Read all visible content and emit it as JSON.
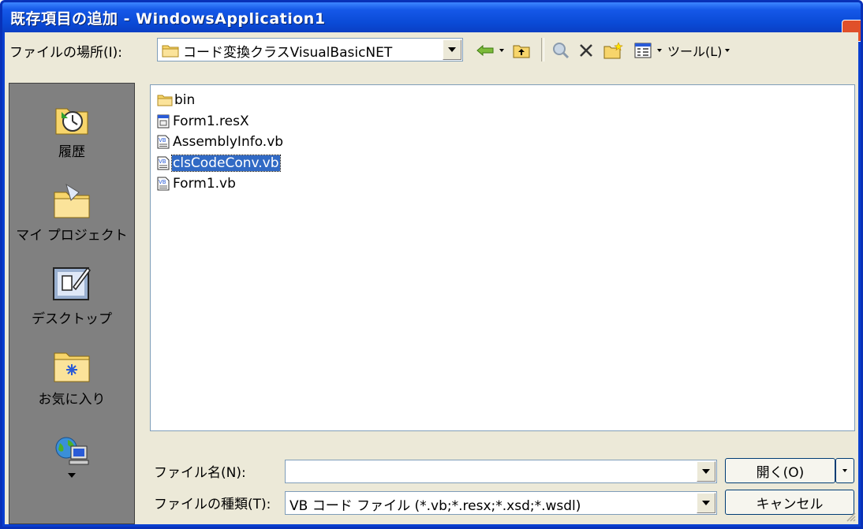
{
  "window": {
    "title": "既存項目の追加 - WindowsApplication1"
  },
  "toolbar": {
    "location_label": "ファイルの場所(I):",
    "location_value": "コード変換クラスVisualBasicNET",
    "tools_label": "ツール(L)"
  },
  "places": [
    {
      "label": "履歴",
      "icon": "history-icon"
    },
    {
      "label": "マイ プロジェクト",
      "icon": "my-projects-folder-icon"
    },
    {
      "label": "デスクトップ",
      "icon": "desktop-icon"
    },
    {
      "label": "お気に入り",
      "icon": "favorites-folder-icon"
    },
    {
      "label": "",
      "icon": "network-computer-icon"
    }
  ],
  "files": [
    {
      "name": "bin",
      "icon": "folder-icon",
      "selected": false
    },
    {
      "name": "Form1.resX",
      "icon": "resx-file-icon",
      "selected": false
    },
    {
      "name": "AssemblyInfo.vb",
      "icon": "vb-file-icon",
      "selected": false
    },
    {
      "name": "clsCodeConv.vb",
      "icon": "vb-file-icon",
      "selected": true
    },
    {
      "name": "Form1.vb",
      "icon": "vb-file-icon",
      "selected": false
    }
  ],
  "footer": {
    "filename_label": "ファイル名(N):",
    "filename_value": "",
    "filetype_label": "ファイルの種類(T):",
    "filetype_value": "VB コード ファイル (*.vb;*.resx;*.xsd;*.wsdl)",
    "open_label": "開く(O)",
    "cancel_label": "キャンセル"
  },
  "colors": {
    "titlebar": "#0a4ad6",
    "selection": "#316ac5",
    "places_bg": "#808080"
  }
}
